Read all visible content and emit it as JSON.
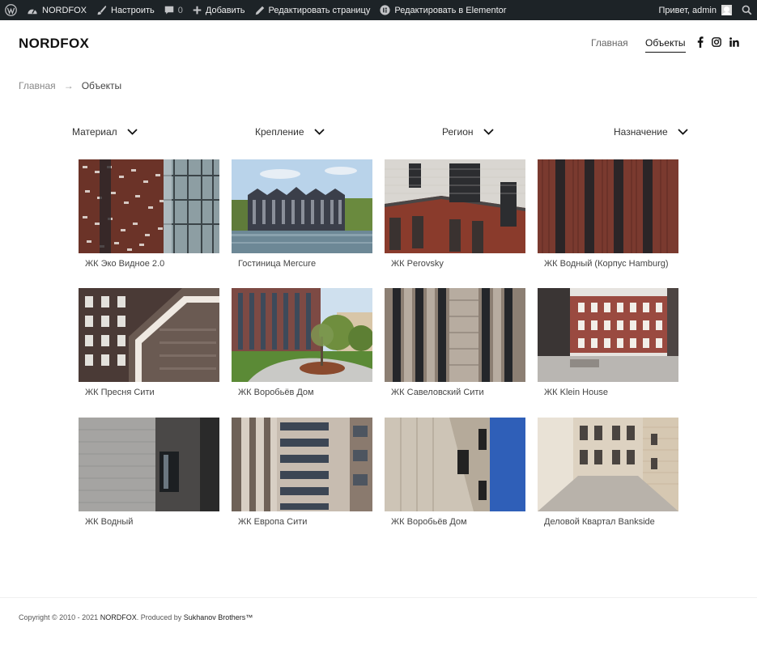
{
  "adminbar": {
    "site_name": "NORDFOX",
    "customize": "Настроить",
    "comments_count": "0",
    "add_new": "Добавить",
    "edit_page": "Редактировать страницу",
    "edit_elementor": "Редактировать в Elementor",
    "greeting": "Привет, admin"
  },
  "header": {
    "logo": "NORDFOX",
    "nav": [
      "Главная",
      "Объекты"
    ]
  },
  "breadcrumb": {
    "home": "Главная",
    "arrow": "→",
    "current": "Объекты"
  },
  "filters": [
    "Материал",
    "Крепление",
    "Регион",
    "Назначение"
  ],
  "projects": [
    {
      "title": "ЖК Эко Видное 2.0"
    },
    {
      "title": "Гостиница Mercure"
    },
    {
      "title": "ЖК Perovsky"
    },
    {
      "title": "ЖК Водный (Корпус Hamburg)"
    },
    {
      "title": "ЖК Пресня Сити"
    },
    {
      "title": "ЖК Воробьёв Дом"
    },
    {
      "title": "ЖК Савеловский Сити"
    },
    {
      "title": "ЖК Klein House"
    },
    {
      "title": "ЖК Водный"
    },
    {
      "title": "ЖК Европа Сити"
    },
    {
      "title": "ЖК Воробьёв Дом"
    },
    {
      "title": "Деловой Квартал Bankside"
    }
  ],
  "footer": {
    "prefix": "Copyright © 2010 - 2021 ",
    "brand": "NORDFOX",
    "middle": ". Produced by ",
    "producer": "Sukhanov Brothers™"
  }
}
